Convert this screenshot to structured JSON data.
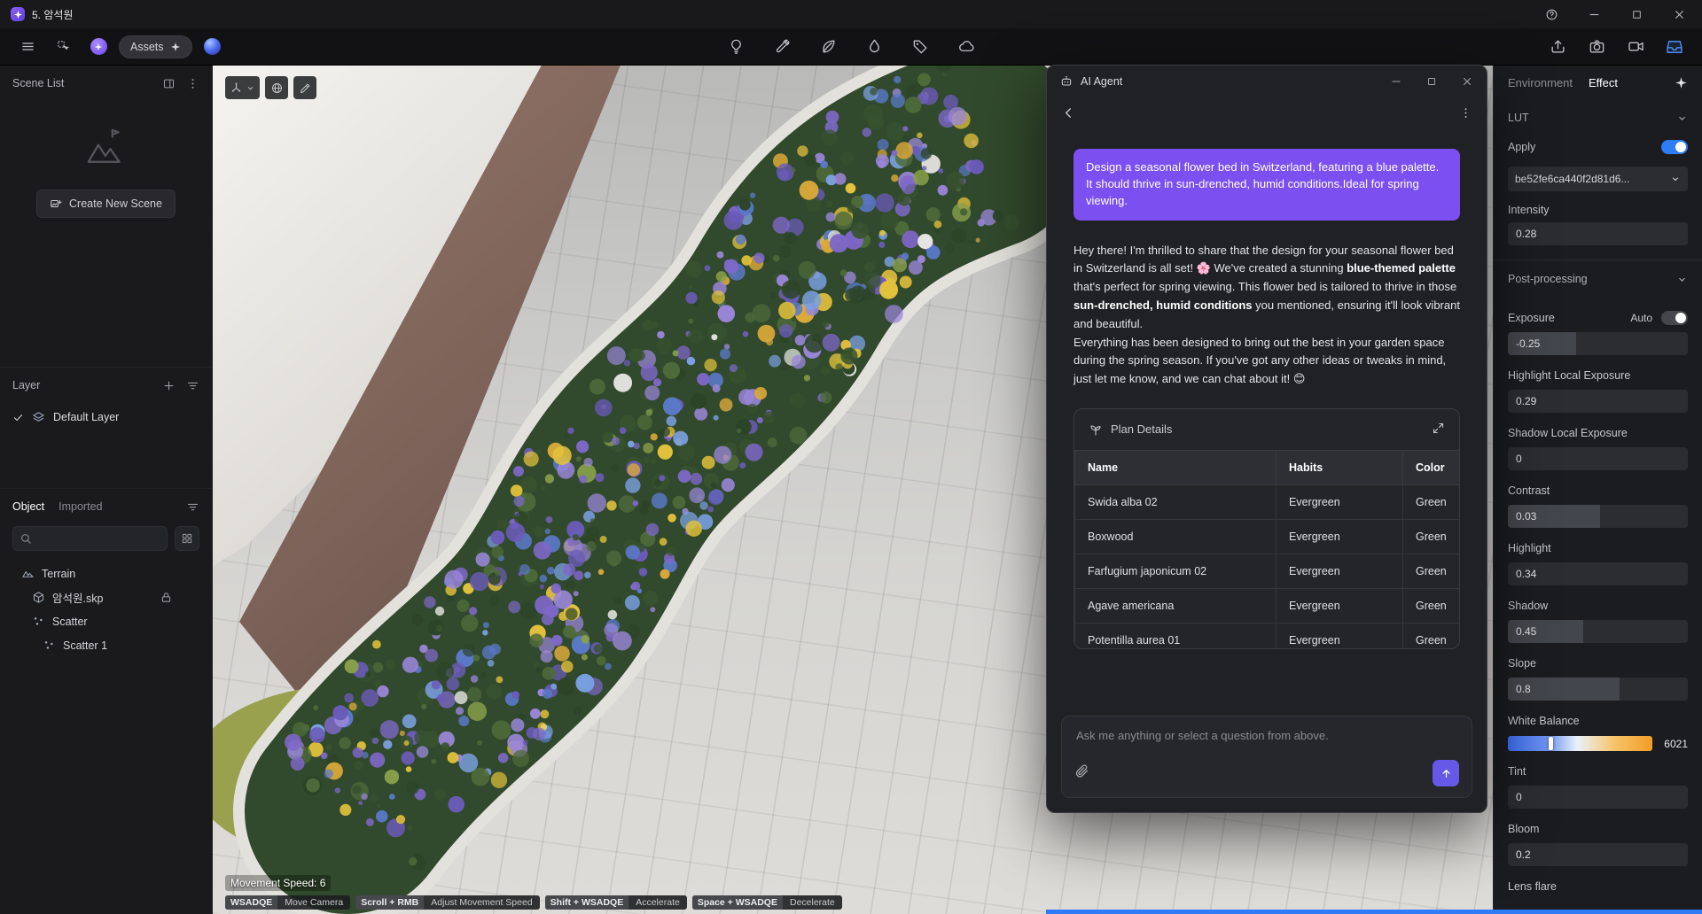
{
  "titlebar": {
    "title": "5. 암석원"
  },
  "toolbar": {
    "assets_label": "Assets"
  },
  "scene_list": {
    "title": "Scene List",
    "create_button_label": "Create New Scene"
  },
  "layer_panel": {
    "title": "Layer",
    "layers": [
      {
        "label": "Default Layer",
        "visible": true
      }
    ]
  },
  "object_panel": {
    "tabs": [
      {
        "label": "Object",
        "active": true
      },
      {
        "label": "Imported",
        "active": false
      }
    ],
    "items": [
      {
        "label": "Terrain",
        "icon": "terrain-icon",
        "indent": 0,
        "locked": false
      },
      {
        "label": "암석원.skp",
        "icon": "model-icon",
        "indent": 1,
        "locked": true
      },
      {
        "label": "Scatter",
        "icon": "scatter-icon",
        "indent": 1,
        "locked": false
      },
      {
        "label": "Scatter 1",
        "icon": "scatter-icon",
        "indent": 2,
        "locked": false
      }
    ]
  },
  "viewport": {
    "movement_speed": "Movement Speed: 6",
    "shortcuts": [
      {
        "keys": "WSADQE",
        "action": "Move Camera"
      },
      {
        "keys": "Scroll + RMB",
        "action": "Adjust Movement Speed"
      },
      {
        "keys": "Shift + WSADQE",
        "action": "Accelerate"
      },
      {
        "keys": "Space + WSADQE",
        "action": "Decelerate"
      }
    ]
  },
  "ai_agent": {
    "window_title": "AI Agent",
    "user_message": "Design a seasonal flower bed in Switzerland, featuring a blue palette. It should thrive in sun-drenched, humid conditions.Ideal for spring viewing.",
    "assistant_message": [
      {
        "text": "Hey there! I'm thrilled to share that the design for your seasonal flower bed in Switzerland is all set! 🌸 We've created a stunning ",
        "bold": false
      },
      {
        "text": "blue-themed palette",
        "bold": true
      },
      {
        "text": " that's perfect for spring viewing. This flower bed is tailored to thrive in those ",
        "bold": false
      },
      {
        "text": "sun-drenched, humid conditions",
        "bold": true
      },
      {
        "text": " you mentioned, ensuring it'll look vibrant and beautiful.\nEverything has been designed to bring out the best in your garden space during the spring season. If you've got any other ideas or tweaks in mind, just let me know, and we can chat about it! 😊",
        "bold": false
      }
    ],
    "plan_details": {
      "title": "Plan Details",
      "columns": [
        "Name",
        "Habits",
        "Color"
      ],
      "rows": [
        [
          "Swida alba 02",
          "Evergreen",
          "Green"
        ],
        [
          "Boxwood",
          "Evergreen",
          "Green"
        ],
        [
          "Farfugium japonicum 02",
          "Evergreen",
          "Green"
        ],
        [
          "Agave americana",
          "Evergreen",
          "Green"
        ],
        [
          "Potentilla aurea 01",
          "Evergreen",
          "Green"
        ]
      ]
    },
    "input_placeholder": "Ask me anything or select a question from above."
  },
  "effect_panel": {
    "tabs": [
      {
        "label": "Environment",
        "active": false
      },
      {
        "label": "Effect",
        "active": true
      }
    ],
    "lut": {
      "title": "LUT",
      "apply_label": "Apply",
      "apply_on": true,
      "preset": "be52fe6ca440f2d81d6...",
      "intensity_label": "Intensity",
      "intensity_value": "0.28"
    },
    "post_processing": {
      "title": "Post-processing",
      "fields": [
        {
          "label": "Exposure",
          "value": "-0.25",
          "fill": 0.38,
          "auto_label": "Auto"
        },
        {
          "label": "Highlight Local Exposure",
          "value": "0.29",
          "fill": 0
        },
        {
          "label": "Shadow Local Exposure",
          "value": "0",
          "fill": 0
        },
        {
          "label": "Contrast",
          "value": "0.03",
          "fill": 0.51
        },
        {
          "label": "Highlight",
          "value": "0.34",
          "fill": 0
        },
        {
          "label": "Shadow",
          "value": "0.45",
          "fill": 0.42
        },
        {
          "label": "Slope",
          "value": "0.8",
          "fill": 0.62
        },
        {
          "label": "White Balance",
          "value": "6021",
          "type": "white_balance",
          "handle": 0.3
        },
        {
          "label": "Tint",
          "value": "0",
          "fill": 0
        },
        {
          "label": "Bloom",
          "value": "0.2",
          "fill": 0
        },
        {
          "label": "Lens flare",
          "value": "",
          "label_only": true
        }
      ]
    }
  },
  "colors": {
    "accent_blue": "#2e7cf6",
    "user_bubble_purple": "#7c4ff0",
    "send_button_purple": "#6659e7"
  }
}
